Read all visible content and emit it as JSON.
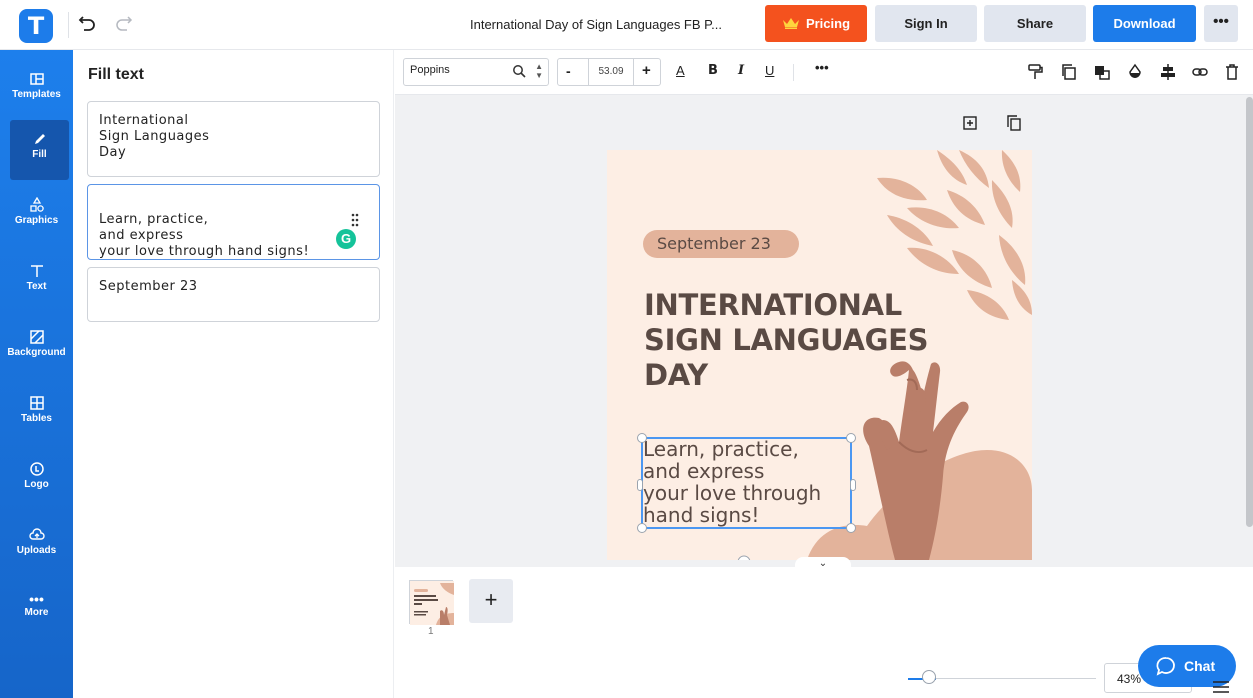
{
  "app": {
    "logo_letter": "T",
    "document_title": "International Day of Sign Languages FB P..."
  },
  "header": {
    "pricing_label": "Pricing",
    "signin_label": "Sign In",
    "share_label": "Share",
    "download_label": "Download",
    "more_label": "•••"
  },
  "colors": {
    "primary": "#1d7cea",
    "pricing": "#f4521e",
    "rail_active": "#1556ad",
    "design_bg": "#fdeee4",
    "design_text": "#5a4a44",
    "pill": "#e3b39b",
    "grammarly": "#15c39a"
  },
  "rail": {
    "items": [
      {
        "label": "Templates",
        "icon": "templates-icon"
      },
      {
        "label": "Fill",
        "icon": "pencil-icon",
        "active": true
      },
      {
        "label": "Graphics",
        "icon": "shapes-icon"
      },
      {
        "label": "Text",
        "icon": "text-icon"
      },
      {
        "label": "Background",
        "icon": "background-icon"
      },
      {
        "label": "Tables",
        "icon": "table-icon"
      },
      {
        "label": "Logo",
        "icon": "logo-icon"
      },
      {
        "label": "Uploads",
        "icon": "cloud-upload-icon"
      },
      {
        "label": "More",
        "icon": "more-dots-icon"
      }
    ]
  },
  "panel": {
    "title": "Fill text",
    "fields": [
      {
        "value": "International\nSign Languages\nDay"
      },
      {
        "value": "Learn, practice,\nand express\nyour love through hand signs!"
      },
      {
        "value": "September 23"
      }
    ],
    "grammarly_letter": "G"
  },
  "toolbar": {
    "font_name": "Poppins",
    "font_size": "53.09",
    "minus": "-",
    "plus": "+",
    "text_color": "A",
    "bold": "B",
    "italic": "I",
    "underline": "U",
    "more": "•••"
  },
  "design": {
    "date": "September 23",
    "headline": "INTERNATIONAL\nSIGN LANGUAGES\nDAY",
    "subtext": "Learn, practice,\nand express\nyour love through\nhand signs!"
  },
  "pages": {
    "page_number": "1",
    "add_label": "+"
  },
  "zoom": {
    "value": "43%",
    "level_fraction": 0.43
  },
  "chat": {
    "label": "Chat"
  }
}
